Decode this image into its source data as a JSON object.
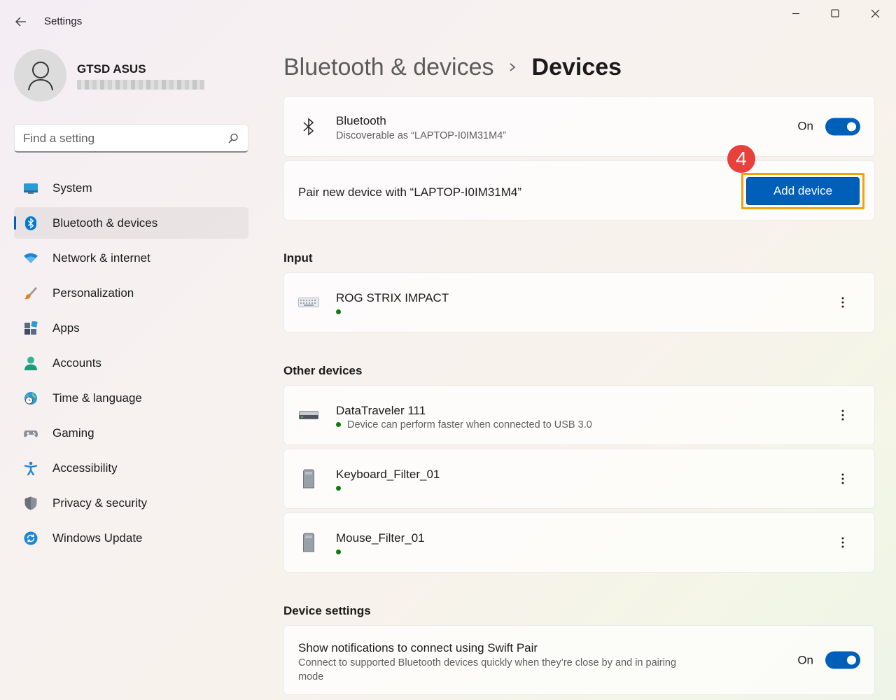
{
  "window": {
    "title": "Settings"
  },
  "user": {
    "name": "GTSD ASUS"
  },
  "search": {
    "placeholder": "Find a setting"
  },
  "nav": {
    "items": [
      {
        "label": "System",
        "icon": "monitor-icon"
      },
      {
        "label": "Bluetooth & devices",
        "icon": "bluetooth-icon",
        "active": true
      },
      {
        "label": "Network & internet",
        "icon": "wifi-icon"
      },
      {
        "label": "Personalization",
        "icon": "brush-icon"
      },
      {
        "label": "Apps",
        "icon": "apps-icon"
      },
      {
        "label": "Accounts",
        "icon": "person-icon"
      },
      {
        "label": "Time & language",
        "icon": "globe-clock-icon"
      },
      {
        "label": "Gaming",
        "icon": "gamepad-icon"
      },
      {
        "label": "Accessibility",
        "icon": "accessibility-icon"
      },
      {
        "label": "Privacy & security",
        "icon": "shield-icon"
      },
      {
        "label": "Windows Update",
        "icon": "refresh-icon"
      }
    ]
  },
  "breadcrumb": {
    "parent": "Bluetooth & devices",
    "current": "Devices"
  },
  "bluetooth": {
    "title": "Bluetooth",
    "subtitle": "Discoverable as “LAPTOP-I0IM31M4”",
    "state": "On"
  },
  "pair": {
    "text": "Pair new device with “LAPTOP-I0IM31M4”",
    "button": "Add device",
    "step": "4"
  },
  "input": {
    "heading": "Input",
    "devices": [
      {
        "name": "ROG STRIX IMPACT",
        "icon": "keyboard-icon"
      }
    ]
  },
  "other": {
    "heading": "Other devices",
    "devices": [
      {
        "name": "DataTraveler 111",
        "status": "Device can perform faster when connected to USB 3.0",
        "icon": "usb-drive-icon"
      },
      {
        "name": "Keyboard_Filter_01",
        "icon": "tower-icon"
      },
      {
        "name": "Mouse_Filter_01",
        "icon": "tower-icon"
      }
    ]
  },
  "device_settings": {
    "heading": "Device settings",
    "swift_pair": {
      "title": "Show notifications to connect using Swift Pair",
      "description_line1": "Connect to supported Bluetooth devices quickly when they’re close by and in pairing",
      "description_line2": "mode",
      "state": "On"
    }
  },
  "colors": {
    "accent": "#005fb8",
    "highlight": "#f0a30a",
    "badge": "#e8413b",
    "status_ok": "#0f7b0f"
  }
}
